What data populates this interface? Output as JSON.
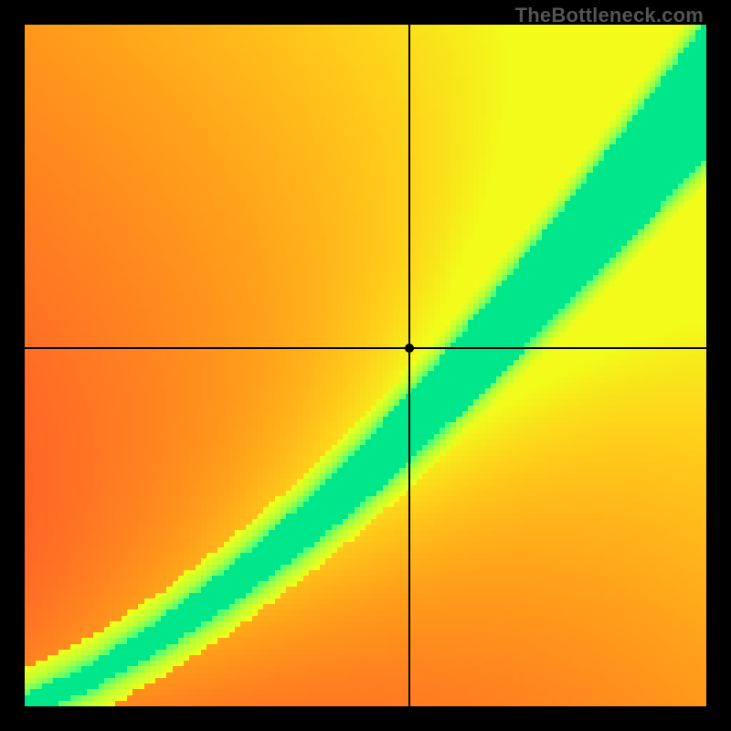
{
  "watermark": "TheBottleneck.com",
  "chart_data": {
    "type": "heatmap",
    "title": "",
    "xlabel": "",
    "ylabel": "",
    "xlim": [
      0,
      1
    ],
    "ylim": [
      0,
      1
    ],
    "grid": false,
    "legend": false,
    "resolution": 120,
    "colormap_stops": [
      {
        "t": 0.0,
        "color": "#ff1a44"
      },
      {
        "t": 0.3,
        "color": "#ff5a2a"
      },
      {
        "t": 0.55,
        "color": "#ff9e1a"
      },
      {
        "t": 0.72,
        "color": "#ffd21a"
      },
      {
        "t": 0.85,
        "color": "#f2ff1a"
      },
      {
        "t": 0.93,
        "color": "#b6ff3a"
      },
      {
        "t": 0.975,
        "color": "#4cff7a"
      },
      {
        "t": 1.0,
        "color": "#00e68a"
      }
    ],
    "ridge_curve": {
      "description": "locus of score=1 (green ridge) as (x, y) fractions over [0,1]; approximates y = x^1.45 * 0.9 + 0.05*x",
      "points": [
        [
          0.0,
          0.0
        ],
        [
          0.1,
          0.045
        ],
        [
          0.2,
          0.105
        ],
        [
          0.3,
          0.175
        ],
        [
          0.4,
          0.255
        ],
        [
          0.5,
          0.345
        ],
        [
          0.6,
          0.445
        ],
        [
          0.7,
          0.555
        ],
        [
          0.8,
          0.668
        ],
        [
          0.9,
          0.785
        ],
        [
          1.0,
          0.905
        ]
      ]
    },
    "ridge_width": {
      "description": "half-width of green band in y-units as function of x",
      "points": [
        [
          0.0,
          0.01
        ],
        [
          0.2,
          0.018
        ],
        [
          0.4,
          0.03
        ],
        [
          0.6,
          0.048
        ],
        [
          0.8,
          0.07
        ],
        [
          1.0,
          0.095
        ]
      ]
    },
    "crosshair": {
      "x": 0.565,
      "y": 0.525
    },
    "marker": {
      "x": 0.565,
      "y": 0.525
    }
  }
}
